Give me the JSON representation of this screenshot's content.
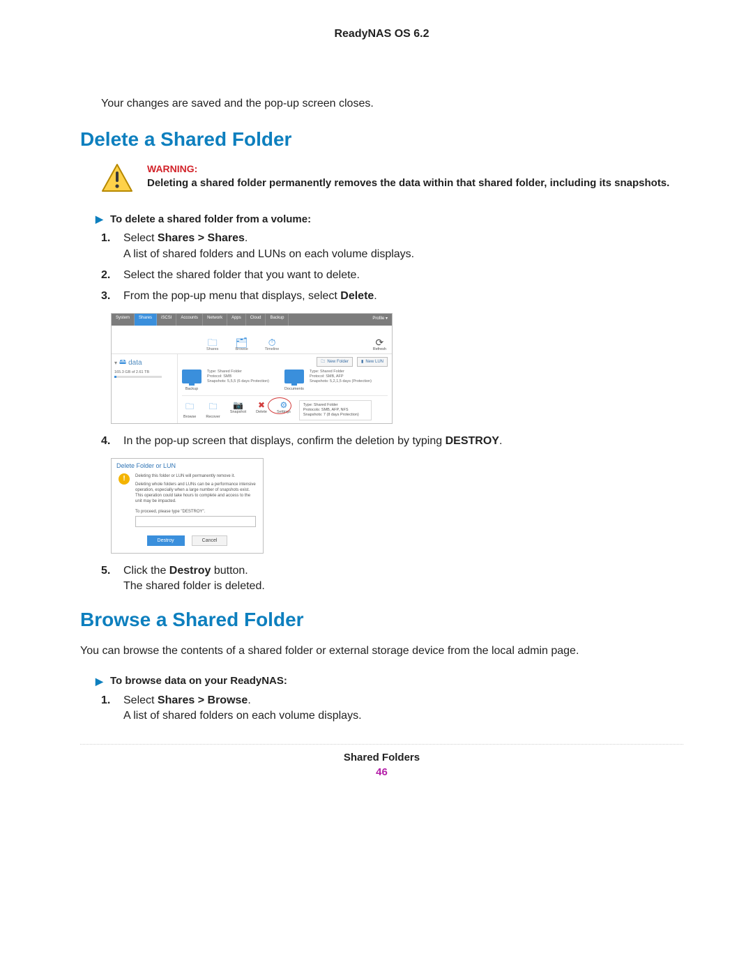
{
  "header": {
    "title": "ReadyNAS OS 6.2"
  },
  "intro_saved": "Your changes are saved and the pop-up screen closes.",
  "section_delete": {
    "title": "Delete a Shared Folder",
    "warning_label": "WARNING:",
    "warning_text": "Deleting a shared folder permanently removes the data within that shared folder, including its snapshots.",
    "procedure_title": "To delete a shared folder from a volume:",
    "steps": {
      "s1_num": "1.",
      "s1_a": "Select ",
      "s1_b": "Shares > Shares",
      "s1_c": ".",
      "s1_d": "A list of shared folders and LUNs on each volume displays.",
      "s2_num": "2.",
      "s2": "Select the shared folder that you want to delete.",
      "s3_num": "3.",
      "s3_a": "From the pop-up menu that displays, select ",
      "s3_b": "Delete",
      "s3_c": ".",
      "s4_num": "4.",
      "s4_a": "In the pop-up screen that displays, confirm the deletion by typing ",
      "s4_b": "DESTROY",
      "s4_c": ".",
      "s5_num": "5.",
      "s5_a": "Click the ",
      "s5_b": "Destroy",
      "s5_c": " button.",
      "s5_d": "The shared folder is deleted."
    }
  },
  "screenshot1": {
    "tabs": {
      "system": "System",
      "shares": "Shares",
      "iscsi": "iSCSI",
      "accounts": "Accounts",
      "network": "Network",
      "apps": "Apps",
      "cloud": "Cloud",
      "backup": "Backup",
      "profile": "Profile ▾"
    },
    "icons": {
      "shares": "Shares",
      "browse": "Browse",
      "timeline": "Timeline",
      "refresh": "Refresh"
    },
    "volume": {
      "name": "data",
      "size": "165.3 GB of 2.61 TB"
    },
    "buttons": {
      "new_folder": "New Folder",
      "new_lun": "New LUN"
    },
    "share_backup": {
      "label": "Backup",
      "meta_type": "Type: Shared Folder",
      "meta_proto": "Protocol: SMB",
      "meta_snap": "Snapshots: 5,5,5 (6 days Protection)"
    },
    "share_documents": {
      "label": "Documents",
      "meta_type": "Type: Shared Folder",
      "meta_proto": "Protocol: SMB, AFP",
      "meta_snap": "Snapshots: 5,2,1,5 days (Protection)"
    },
    "actions": {
      "browse": "Browse",
      "recover": "Recover",
      "snapshot": "Snapshot",
      "delete": "Delete",
      "settings": "Settings"
    },
    "sidecard": {
      "l1": "Type: Shared Folder",
      "l2": "Protocols: SMB, AFP, NFS",
      "l3": "Snapshots: 7 (8 days Protection)"
    }
  },
  "screenshot2": {
    "title": "Delete Folder or LUN",
    "line1": "Deleting this folder or LUN will permanently remove it.",
    "line2": "Deleting whole folders and LUNs can be a performance intensive operation, especially when a large number of snapshots exist. This operation could take hours to complete and access to the unit may be impacted.",
    "proceed": "To proceed, please type \"DESTROY\".",
    "btn_destroy": "Destroy",
    "btn_cancel": "Cancel"
  },
  "section_browse": {
    "title": "Browse a Shared Folder",
    "intro": "You can browse the contents of a shared folder or external storage device from the local admin page.",
    "procedure_title": "To browse data on your ReadyNAS:",
    "steps": {
      "s1_num": "1.",
      "s1_a": "Select ",
      "s1_b": "Shares > Browse",
      "s1_c": ".",
      "s1_d": "A list of shared folders on each volume displays."
    }
  },
  "footer": {
    "title": "Shared Folders",
    "page": "46"
  }
}
